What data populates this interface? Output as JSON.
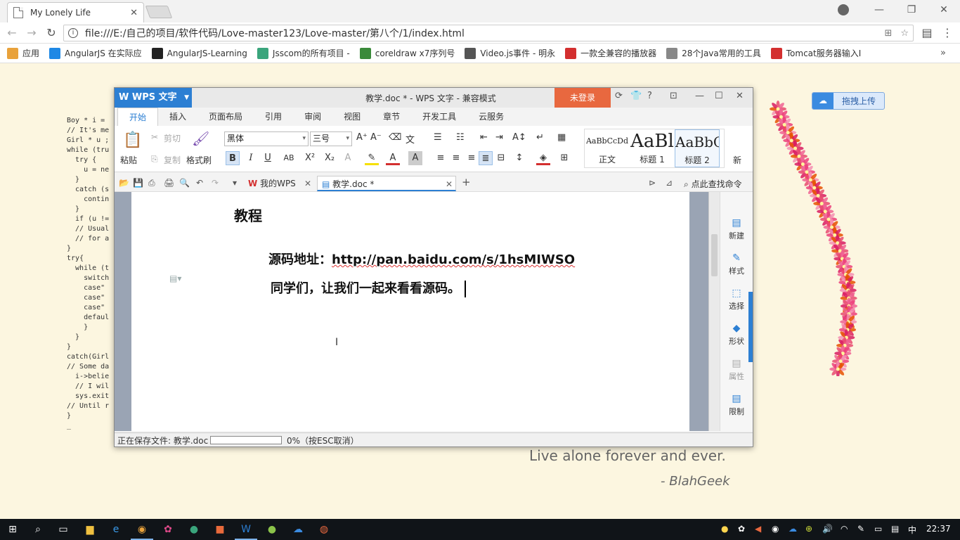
{
  "browser": {
    "tab_title": "My Lonely Life",
    "url": "file:///E:/自己的项目/软件代码/Love-master123/Love-master/第八个/1/index.html",
    "bookmarks": [
      {
        "label": "应用",
        "color": "#e9a23b"
      },
      {
        "label": "AngularJS 在实际应",
        "color": "#1e88e5"
      },
      {
        "label": "AngularJS-Learning",
        "color": "#222222"
      },
      {
        "label": "Jsscom的所有项目 -",
        "color": "#3aa57c"
      },
      {
        "label": "coreldraw x7序列号",
        "color": "#3a8a3a"
      },
      {
        "label": "Video.js事件 - 明永",
        "color": "#555555"
      },
      {
        "label": "一款全兼容的播放器",
        "color": "#d32f2f"
      },
      {
        "label": "28个Java常用的工具",
        "color": "#888888"
      },
      {
        "label": "Tomcat服务器输入I",
        "color": "#d32f2f"
      }
    ],
    "bookmark_more": "»"
  },
  "page": {
    "code_lines": [
      "Boy * i = ",
      "// It's me",
      "Girl * u ;",
      "while (tru",
      "  try {",
      "    u = ne",
      "  }",
      "  catch (s",
      "    contin",
      "  }",
      "  if (u !=",
      "  // Usual",
      "  // for a",
      "}",
      "try{",
      "  while (t",
      "    switch",
      "    case\"",
      "    case\"",
      "    case\"",
      "    defaul",
      "    }",
      "  }",
      "}",
      "catch(Girl",
      "// Some da",
      "  i->belie",
      "  // I wil",
      "  sys.exit",
      "// Until r",
      "}",
      "_"
    ],
    "quote": "Live alone forever and ever.",
    "author": "- BlahGeek",
    "upload_label": "拖拽上传"
  },
  "wps": {
    "app_name": "WPS 文字",
    "window_title": "教学.doc * - WPS 文字 - 兼容模式",
    "login": "未登录",
    "ribbon_tabs": [
      "开始",
      "插入",
      "页面布局",
      "引用",
      "审阅",
      "视图",
      "章节",
      "开发工具",
      "云服务"
    ],
    "ribbon": {
      "paste": "粘贴",
      "cut": "剪切",
      "copy": "复制",
      "format_painter": "格式刷",
      "font_name": "黑体",
      "font_size": "三号",
      "new_style": "新",
      "styles": [
        {
          "preview": "AaBbCcDd",
          "caption": "正文"
        },
        {
          "preview": "AaBl",
          "caption": "标题 1"
        },
        {
          "preview": "AaBbC",
          "caption": "标题 2"
        }
      ]
    },
    "doc_tabs": [
      {
        "label": "我的WPS"
      },
      {
        "label": "教学.doc *"
      }
    ],
    "search_command": "点此查找命令",
    "document": {
      "heading": "教程",
      "line1_prefix": "源码地址：",
      "line1_url": "http://pan.baidu.com/s/1hsMIWSO",
      "line2": "同学们，让我们一起来看看源码。"
    },
    "side_panel": [
      {
        "label": "新建"
      },
      {
        "label": "样式"
      },
      {
        "label": "选择"
      },
      {
        "label": "形状"
      },
      {
        "label": "属性"
      },
      {
        "label": "限制"
      }
    ],
    "status": {
      "saving": "正在保存文件: 教学.doc",
      "progress": 0,
      "progress_text": "0%（按ESC取消）"
    }
  },
  "taskbar": {
    "ime": "中",
    "time": "22:37"
  }
}
